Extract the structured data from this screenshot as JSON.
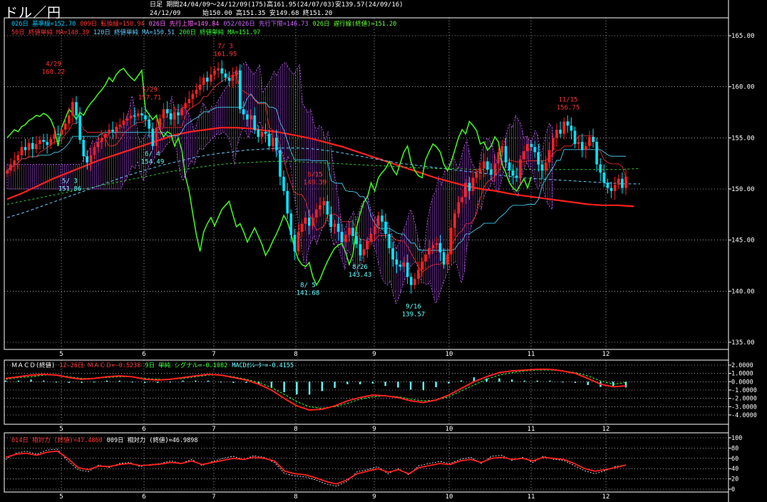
{
  "header": {
    "title": "ドル／円",
    "period_line": "日足  期間24/04/09～24/12/09(175)高161.95(24/07/03)安139.57(24/09/16)",
    "quote_date": "24/12/09",
    "quote_line": "始150.00 高151.35 安149.68 終151.20"
  },
  "legend": {
    "line1": [
      {
        "text": "026日 基準線=152.70",
        "color": "#00ccff"
      },
      {
        "text": "009日 転換線=150.94",
        "color": "#ff3333"
      },
      {
        "text": "026日 先行上限=149.84",
        "color": "#ff66ff"
      },
      {
        "text": "052/026日 先行下限=146.73",
        "color": "#cc66ff"
      },
      {
        "text": "026日 遅行線(終値)=151.20",
        "color": "#66ff33"
      }
    ],
    "line2": [
      {
        "text": "50日 終値単純 MA=148.39",
        "color": "#ff3333"
      },
      {
        "text": "120日 終値単純 MA=150.51",
        "color": "#66ccff"
      },
      {
        "text": "200日 終値単純 MA=151.97",
        "color": "#33ff33"
      }
    ],
    "macd": [
      {
        "text": "ＭＡＣＤ(終値)",
        "color": "#ffffff"
      },
      {
        "text": "12-26日 ＭＡＣＤ=-0.5238",
        "color": "#ff3333"
      },
      {
        "text": "9日 単純 シグナル=-0.1082",
        "color": "#33ff33"
      },
      {
        "text": "MACDｵｼﾚｰﾀｰ=-0.4155",
        "color": "#66ffff"
      }
    ],
    "rsi": [
      {
        "text": "014日 相対力 (終値)=47.4860",
        "color": "#ff3333"
      },
      {
        "text": "009日 相対力 (終値)=46.9898",
        "color": "#ffffff"
      }
    ]
  },
  "colors": {
    "up": "#ff2020",
    "down": "#00e5ff",
    "grid": "#ffffff",
    "ma50": "#ff2020",
    "ma120": "#66ccff",
    "ma200": "#33cc33",
    "kijun": "#40ccee",
    "tenkan": "#ff3030",
    "chikou": "#44ee22",
    "cloud": "#cc66ff"
  },
  "chart_data": [
    {
      "type": "candlestick",
      "ylim": [
        135,
        165
      ],
      "y_ticks": [
        "135.00",
        "140.00",
        "145.00",
        "150.00",
        "155.00",
        "160.00",
        "165.00"
      ],
      "y_values": [
        135,
        140,
        145,
        150,
        155,
        160,
        165
      ],
      "month_labels": [
        "5",
        "6",
        "7",
        "8",
        "9",
        "10",
        "11",
        "12"
      ],
      "close": [
        151.8,
        152.4,
        152.8,
        153.3,
        154.1,
        153.8,
        154.5,
        153.9,
        154.4,
        154.8,
        154.6,
        154.3,
        154.9,
        155.4,
        155.3,
        155.8,
        156.4,
        157.2,
        158.5,
        157.2,
        154.8,
        153.2,
        152.6,
        153.3,
        154.1,
        154.6,
        155.0,
        155.4,
        155.8,
        155.6,
        156.1,
        156.3,
        156.7,
        156.9,
        157.2,
        157.1,
        157.4,
        157.2,
        156.8,
        155.9,
        154.2,
        156.0,
        156.9,
        157.8,
        157.4,
        156.8,
        157.5,
        157.2,
        157.9,
        158.4,
        158.8,
        159.3,
        159.7,
        160.2,
        160.9,
        160.5,
        161.2,
        161.6,
        161.8,
        161.3,
        160.9,
        160.6,
        161.1,
        161.6,
        157.8,
        157.3,
        156.8,
        157.2,
        155.8,
        155.1,
        155.6,
        155.4,
        154.2,
        155.0,
        153.8,
        151.2,
        149.8,
        147.6,
        145.5,
        143.9,
        145.8,
        146.6,
        147.2,
        146.4,
        147.2,
        148.0,
        148.4,
        148.8,
        147.5,
        146.3,
        146.6,
        145.8,
        144.8,
        145.5,
        146.2,
        145.4,
        144.6,
        143.5,
        144.1,
        144.9,
        145.6,
        146.4,
        147.4,
        146.8,
        145.6,
        144.2,
        143.1,
        142.6,
        142.4,
        142.8,
        141.4,
        140.6,
        141.2,
        142.1,
        142.9,
        143.6,
        144.2,
        144.5,
        144.7,
        143.8,
        142.6,
        143.6,
        146.2,
        147.6,
        148.7,
        149.2,
        150.6,
        149.8,
        151.1,
        151.6,
        152.0,
        152.7,
        151.9,
        151.4,
        152.5,
        153.6,
        154.2,
        152.6,
        151.8,
        151.3,
        151.1,
        152.9,
        153.7,
        154.4,
        154.1,
        153.6,
        152.4,
        151.8,
        152.6,
        153.8,
        155.0,
        155.8,
        155.4,
        156.6,
        156.2,
        155.7,
        154.4,
        154.6,
        153.8,
        154.2,
        155.1,
        154.6,
        152.4,
        151.6,
        150.6,
        150.1,
        149.8,
        150.4,
        151.0,
        150.1,
        151.2
      ],
      "open_close_note": "open = previous close",
      "series": [
        {
          "name": "50日 終値単純 MA",
          "values": [
            149.0,
            149.6,
            150.3,
            151.0,
            151.6,
            152.2,
            152.8,
            153.3,
            153.8,
            154.3,
            154.8,
            155.3,
            155.6,
            155.8,
            156.0,
            156.0,
            155.9,
            155.7,
            155.5,
            155.2,
            154.9,
            154.5,
            154.1,
            153.6,
            153.1,
            152.6,
            152.1,
            151.6,
            151.1,
            150.7,
            150.3,
            150.0,
            149.8,
            149.5,
            149.3,
            149.1,
            148.9,
            148.7,
            148.5,
            148.4,
            148.4,
            148.3
          ],
          "x_start": 0,
          "x_step": 4.2
        },
        {
          "name": "120日 終値単純 MA",
          "values": [
            147.2,
            147.7,
            148.3,
            148.9,
            149.5,
            150.1,
            150.7,
            151.3,
            151.8,
            152.3,
            152.7,
            153.1,
            153.4,
            153.6,
            153.8,
            153.9,
            154.0,
            154.0,
            153.9,
            153.7,
            153.4,
            153.1,
            152.8,
            152.5,
            152.3,
            152.1,
            151.9,
            151.7,
            151.5,
            151.3,
            151.1,
            151.0,
            150.9,
            150.8,
            150.7,
            150.6,
            150.5,
            150.5
          ],
          "x_start": 0,
          "x_step": 4.7
        },
        {
          "name": "200日 終値単純 MA",
          "values": [
            148.5,
            148.9,
            149.3,
            149.7,
            150.1,
            150.5,
            150.9,
            151.3,
            151.7,
            152.0,
            152.3,
            152.5,
            152.6,
            152.7,
            152.7,
            152.6,
            152.5,
            152.4,
            152.3,
            152.2,
            152.1,
            152.0,
            152.0,
            151.9,
            151.9,
            151.9,
            151.9,
            151.9,
            151.9,
            151.9,
            151.9,
            152.0
          ],
          "x_start": 0,
          "x_step": 5.6
        }
      ],
      "annotations": [
        {
          "text": "4/29",
          "value": 160.22,
          "color": "#ff3333"
        },
        {
          "text": "160.22",
          "value": 160.22,
          "color": "#ff3333"
        },
        {
          "text": "5/ 3",
          "value": 151.86,
          "color": "#66ffff"
        },
        {
          "text": "151.86",
          "value": 151.86,
          "color": "#66ffff"
        },
        {
          "text": "5/29",
          "value": 157.71,
          "color": "#ff3333"
        },
        {
          "text": "157.71",
          "value": 157.71,
          "color": "#ff3333"
        },
        {
          "text": "6/ 4",
          "value": 154.49,
          "color": "#66ffff"
        },
        {
          "text": "154.49",
          "value": 154.49,
          "color": "#66ffff"
        },
        {
          "text": "7/ 3",
          "value": 161.95,
          "color": "#ff3333"
        },
        {
          "text": "161.95",
          "value": 161.95,
          "color": "#ff3333"
        },
        {
          "text": "8/ 5",
          "value": 141.68,
          "color": "#66ffff"
        },
        {
          "text": "141.68",
          "value": 141.68,
          "color": "#66ffff"
        },
        {
          "text": "8/15",
          "value": 149.39,
          "color": "#ff3333"
        },
        {
          "text": "149.39",
          "value": 149.39,
          "color": "#ff3333"
        },
        {
          "text": "8/26",
          "value": 143.43,
          "color": "#66ffff"
        },
        {
          "text": "143.43",
          "value": 143.43,
          "color": "#66ffff"
        },
        {
          "text": "9/16",
          "value": 139.57,
          "color": "#66ffff"
        },
        {
          "text": "139.57",
          "value": 139.57,
          "color": "#66ffff"
        },
        {
          "text": "11/15",
          "value": 156.75,
          "color": "#ff3333"
        },
        {
          "text": "156.75",
          "value": 156.75,
          "color": "#ff3333"
        }
      ]
    },
    {
      "type": "line",
      "title": "ＭＡＣＤ(終値)",
      "ylim": [
        -4,
        2
      ],
      "y_ticks": [
        "2.0000",
        "1.0000",
        "0.0000",
        "-1.0000",
        "-2.0000",
        "-3.0000",
        "-4.0000"
      ],
      "y_values": [
        2,
        1,
        0,
        -1,
        -2,
        -3,
        -4
      ],
      "month_labels": [
        "5",
        "6",
        "7",
        "8",
        "9",
        "10",
        "11",
        "12"
      ],
      "series": [
        {
          "name": "12-26日 ＭＡＣＤ",
          "values": [
            0.4,
            0.6,
            0.8,
            0.9,
            0.8,
            0.5,
            0.3,
            0.4,
            0.6,
            0.7,
            0.6,
            0.3,
            0.2,
            0.3,
            0.5,
            0.7,
            0.9,
            0.8,
            0.5,
            0.2,
            -0.3,
            -1.0,
            -2.0,
            -2.9,
            -3.4,
            -3.3,
            -2.9,
            -2.3,
            -1.9,
            -1.6,
            -1.7,
            -1.9,
            -2.3,
            -2.5,
            -2.2,
            -1.6,
            -0.8,
            0.0,
            0.6,
            1.1,
            1.3,
            1.4,
            1.5,
            1.5,
            1.3,
            1.0,
            0.4,
            -0.3,
            -0.6,
            -0.5
          ]
        },
        {
          "name": "9日 単純 シグナル",
          "values": [
            0.3,
            0.5,
            0.6,
            0.8,
            0.8,
            0.6,
            0.4,
            0.4,
            0.5,
            0.6,
            0.6,
            0.4,
            0.3,
            0.3,
            0.4,
            0.6,
            0.8,
            0.8,
            0.6,
            0.3,
            -0.1,
            -0.7,
            -1.5,
            -2.4,
            -3.0,
            -3.2,
            -3.0,
            -2.6,
            -2.1,
            -1.8,
            -1.7,
            -1.8,
            -2.1,
            -2.3,
            -2.2,
            -1.8,
            -1.1,
            -0.4,
            0.3,
            0.8,
            1.1,
            1.3,
            1.4,
            1.4,
            1.3,
            1.1,
            0.7,
            0.1,
            -0.3,
            -0.1
          ]
        }
      ]
    },
    {
      "type": "line",
      "ylim": [
        0,
        100
      ],
      "y_ticks": [
        "100",
        "80",
        "60",
        "40",
        "20",
        "0"
      ],
      "y_values": [
        100,
        80,
        60,
        40,
        20,
        0
      ],
      "month_labels": [
        "5",
        "6",
        "7",
        "8",
        "9",
        "10",
        "11",
        "12"
      ],
      "series": [
        {
          "name": "014日 相対力 (終値)",
          "values": [
            62,
            68,
            70,
            66,
            72,
            74,
            60,
            42,
            38,
            45,
            44,
            48,
            50,
            46,
            47,
            49,
            52,
            50,
            55,
            48,
            52,
            56,
            60,
            58,
            62,
            60,
            55,
            35,
            30,
            28,
            22,
            15,
            10,
            18,
            30,
            35,
            40,
            33,
            38,
            30,
            42,
            46,
            50,
            48,
            55,
            58,
            52,
            60,
            62,
            58,
            60,
            55,
            62,
            60,
            58,
            50,
            40,
            35,
            38,
            42,
            47
          ]
        },
        {
          "name": "009日 相対力 (終値)",
          "values": [
            58,
            70,
            74,
            68,
            76,
            78,
            55,
            38,
            34,
            47,
            42,
            50,
            52,
            44,
            48,
            50,
            55,
            50,
            58,
            46,
            54,
            60,
            64,
            58,
            65,
            62,
            52,
            30,
            26,
            24,
            18,
            10,
            6,
            15,
            34,
            38,
            44,
            30,
            40,
            28,
            46,
            50,
            54,
            50,
            58,
            62,
            50,
            64,
            66,
            56,
            62,
            52,
            64,
            58,
            56,
            46,
            36,
            30,
            36,
            44,
            47
          ]
        }
      ]
    }
  ]
}
